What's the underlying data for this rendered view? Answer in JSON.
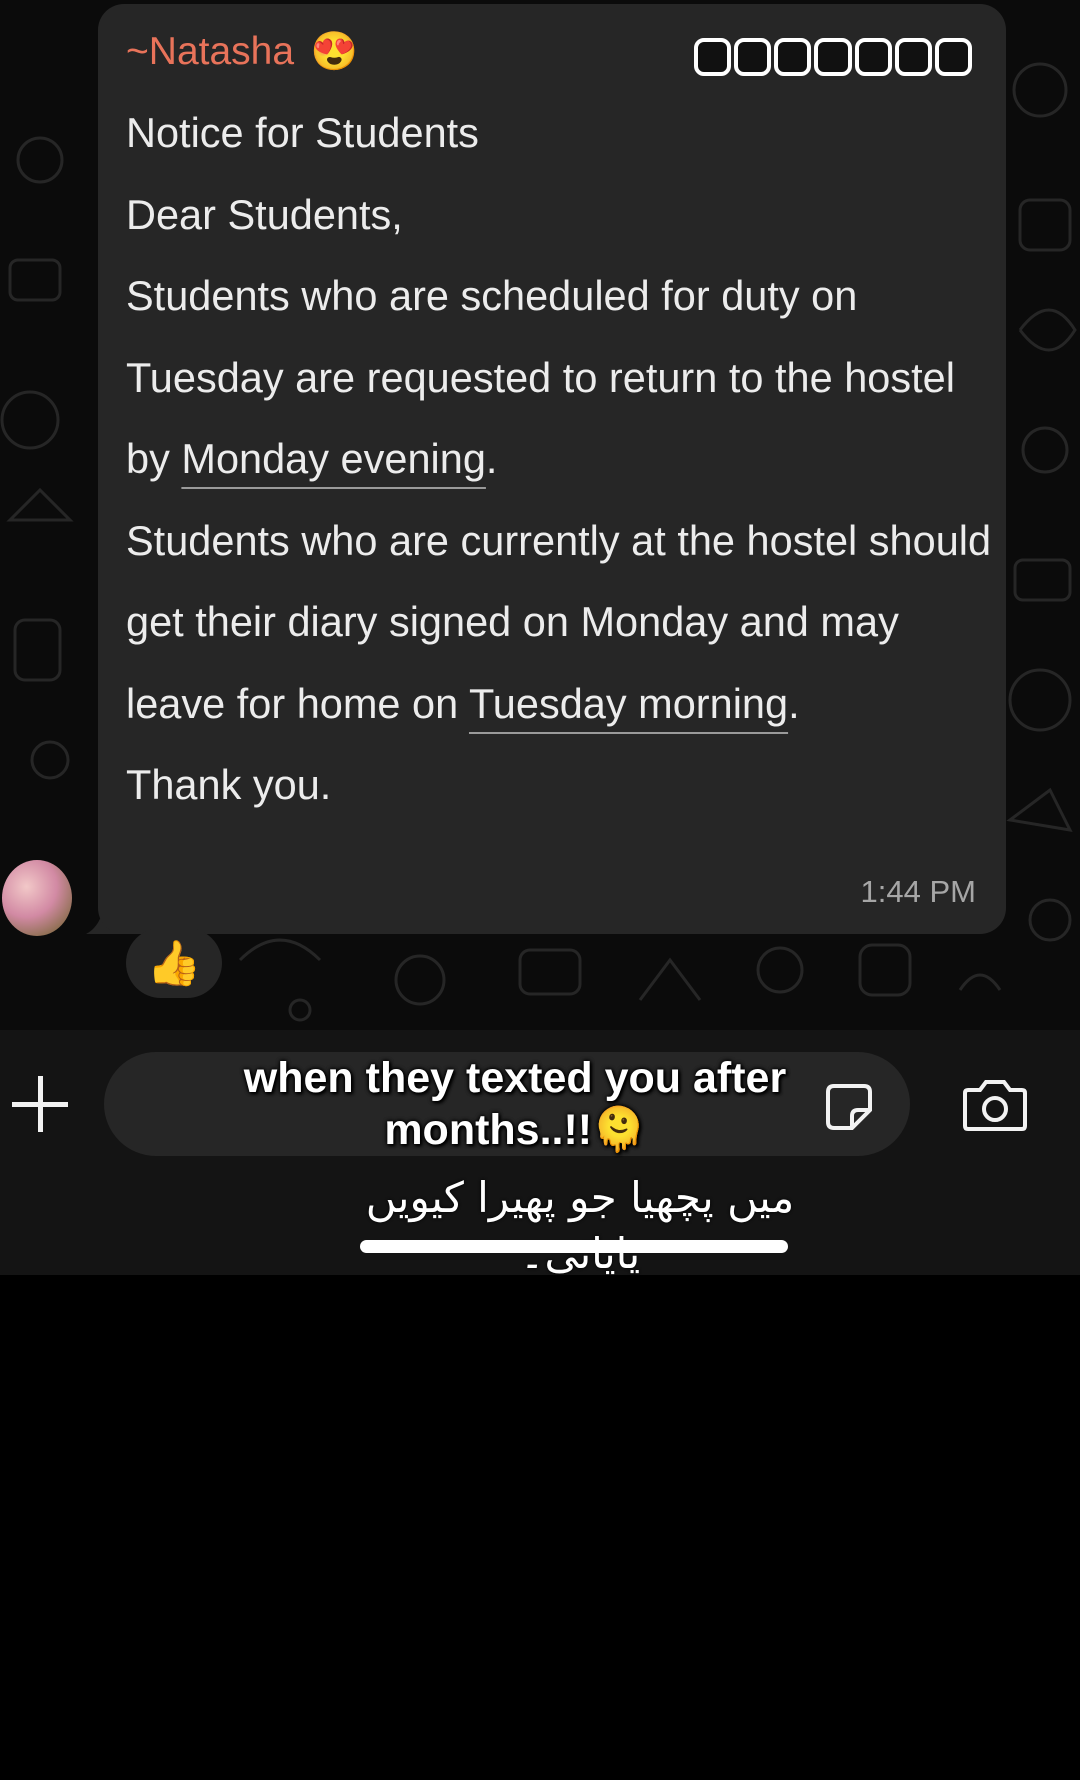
{
  "message": {
    "sender": "~Natasha",
    "sender_emoji": "😍",
    "title": "Notice for Students",
    "greeting": "Dear Students,",
    "para1_a": "Students who are scheduled for duty on Tuesday are requested to return to the hostel by ",
    "para1_link": "Monday evening",
    "para1_b": ".",
    "para2_a": "Students who are currently at the hostel should get their diary signed on Monday and may leave for home on ",
    "para2_link": "Tuesday morning",
    "para2_b": ".",
    "closing": "Thank you.",
    "time": "1:44 PM",
    "reaction": "👍"
  },
  "overlay": {
    "caption_line1": "when they texted you after",
    "caption_line2": "months..!!🫠",
    "urdu_text": "میں پچھیا جو پھیرا کیویں پایائی۔"
  },
  "colors": {
    "sender": "#e8735a",
    "bubble": "#262626",
    "background": "#0b0b0b"
  },
  "icons": [
    "plus-icon",
    "sticker-icon",
    "camera-icon"
  ]
}
